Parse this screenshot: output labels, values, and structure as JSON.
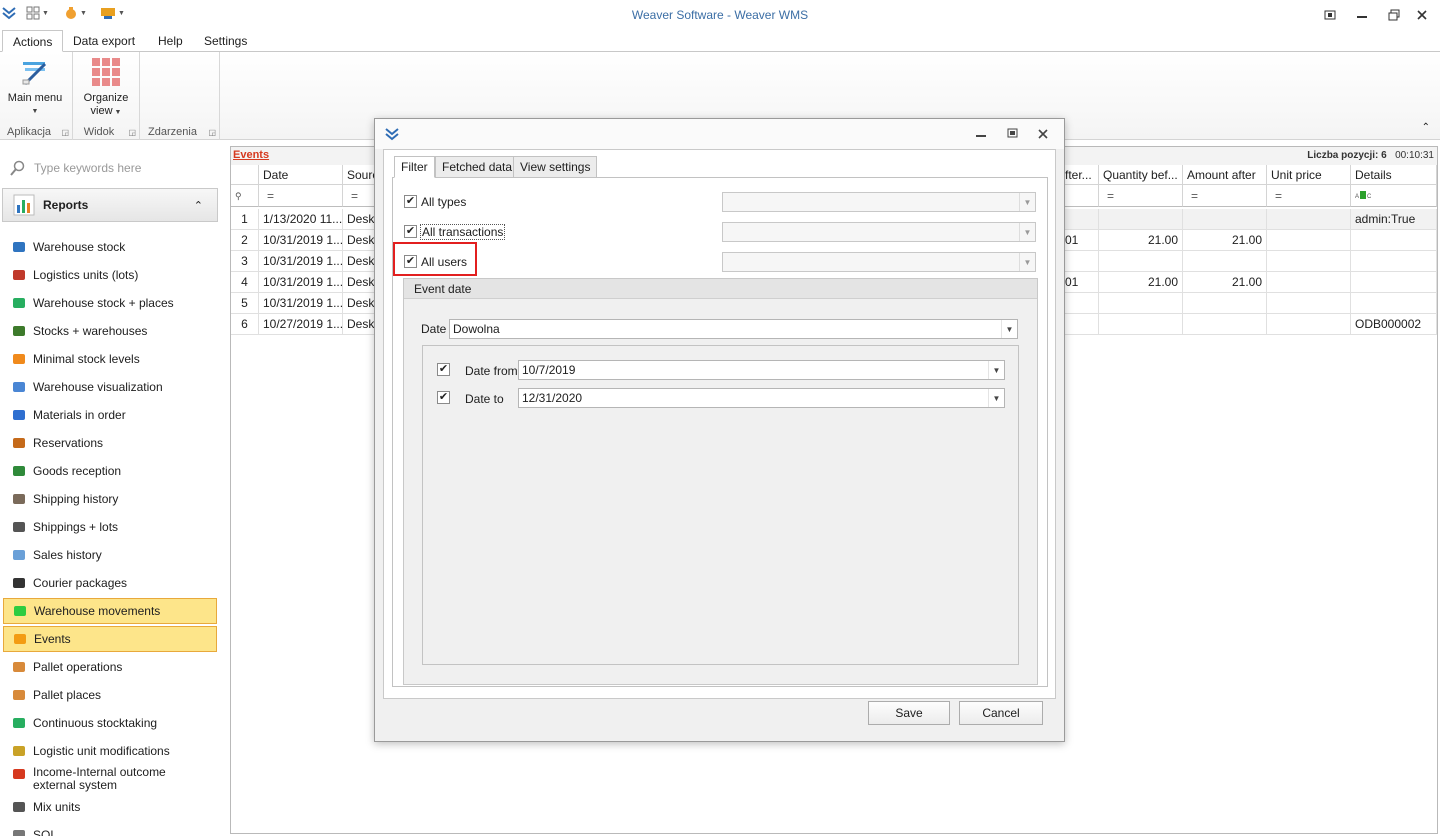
{
  "window": {
    "title": "Weaver Software - Weaver WMS"
  },
  "ribbon": {
    "tabs": [
      "Actions",
      "Data export",
      "Help",
      "Settings"
    ],
    "buttons": {
      "main_menu": "Main menu",
      "organize_view_1": "Organize",
      "organize_view_2": "view"
    },
    "groups": [
      "Aplikacja",
      "Widok",
      "Zdarzenia"
    ]
  },
  "sidebar": {
    "search_placeholder": "Type keywords here",
    "header": "Reports",
    "items": [
      {
        "label": "Warehouse stock",
        "icon": "warehouse-stock-icon",
        "color": "#2f74c0"
      },
      {
        "label": "Logistics units (lots)",
        "icon": "logistics-units-icon",
        "color": "#c0392b"
      },
      {
        "label": "Warehouse stock + places",
        "icon": "stock-places-icon",
        "color": "#27ae60"
      },
      {
        "label": "Stocks + warehouses",
        "icon": "truck-icon",
        "color": "#3d7a2b"
      },
      {
        "label": "Minimal stock levels",
        "icon": "down-arrow-icon",
        "color": "#f08a1c"
      },
      {
        "label": "Warehouse visualization",
        "icon": "map-icon",
        "color": "#4a86d4"
      },
      {
        "label": "Materials in order",
        "icon": "flag-icon",
        "color": "#2e6fd0"
      },
      {
        "label": "Reservations",
        "icon": "tag-icon",
        "color": "#c56a1a"
      },
      {
        "label": "Goods reception",
        "icon": "delivery-truck-icon",
        "color": "#2f8a3a"
      },
      {
        "label": "Shipping history",
        "icon": "shipping-icon",
        "color": "#7a6a5a"
      },
      {
        "label": "Shippings + lots",
        "icon": "pallet-truck-icon",
        "color": "#555555"
      },
      {
        "label": "Sales history",
        "icon": "sales-icon",
        "color": "#6aa0d8"
      },
      {
        "label": "Courier packages",
        "icon": "plane-icon",
        "color": "#333333"
      },
      {
        "label": "Warehouse movements",
        "icon": "arrow-right-icon",
        "color": "#2ecc40"
      },
      {
        "label": "Events",
        "icon": "lightning-icon",
        "color": "#f39c12"
      },
      {
        "label": "Pallet operations",
        "icon": "pallet-icon",
        "color": "#d88a3a"
      },
      {
        "label": "Pallet places",
        "icon": "pallet-place-icon",
        "color": "#d88a3a"
      },
      {
        "label": "Continuous stocktaking",
        "icon": "refresh-icon",
        "color": "#27ae60"
      },
      {
        "label": "Logistic unit modifications",
        "icon": "edit-icon",
        "color": "#c9a227"
      },
      {
        "label": "Income-Internal outcome external system",
        "icon": "exchange-icon",
        "color": "#d6391f"
      },
      {
        "label": "Mix units",
        "icon": "mix-icon",
        "color": "#555555"
      },
      {
        "label": "SQL",
        "icon": "sql-icon",
        "color": "#777777"
      }
    ]
  },
  "grid": {
    "title": "Events",
    "count_label": "Liczba pozycji:",
    "count_value": "6",
    "time": "00:10:31",
    "columns_left": [
      "Date",
      "Sourc"
    ],
    "columns_right": [
      "fter...",
      "Quantity bef...",
      "Amount after",
      "Unit price",
      "Details"
    ],
    "filter_symbol": "=",
    "rows": [
      {
        "n": "1",
        "date": "1/13/2020 11...",
        "source": "Deskt",
        "after": "",
        "qty": "",
        "amount": "",
        "price": "",
        "details": "admin:True"
      },
      {
        "n": "2",
        "date": "10/31/2019 1...",
        "source": "Deskt",
        "after": "01",
        "qty": "21.00",
        "amount": "21.00",
        "price": "",
        "details": ""
      },
      {
        "n": "3",
        "date": "10/31/2019 1...",
        "source": "Deskt",
        "after": "",
        "qty": "",
        "amount": "",
        "price": "",
        "details": ""
      },
      {
        "n": "4",
        "date": "10/31/2019 1...",
        "source": "Deskt",
        "after": "01",
        "qty": "21.00",
        "amount": "21.00",
        "price": "",
        "details": ""
      },
      {
        "n": "5",
        "date": "10/31/2019 1...",
        "source": "Deskt",
        "after": "",
        "qty": "",
        "amount": "",
        "price": "",
        "details": ""
      },
      {
        "n": "6",
        "date": "10/27/2019 1...",
        "source": "Deskt",
        "after": "",
        "qty": "",
        "amount": "",
        "price": "",
        "details": "ODB000002"
      }
    ]
  },
  "dialog": {
    "tabs": [
      "Filter",
      "Fetched data",
      "View settings"
    ],
    "all_types": "All types",
    "all_transactions": "All transactions",
    "all_users": "All users",
    "event_date": "Event date",
    "date_label": "Date",
    "date_value": "Dowolna",
    "date_from_label": "Date from",
    "date_from_value": "10/7/2019",
    "date_to_label": "Date to",
    "date_to_value": "12/31/2020",
    "save": "Save",
    "cancel": "Cancel"
  },
  "colors": {
    "accent": "#3b6ea5",
    "selected_bg": "#fde58a",
    "highlight": "#e21f1f"
  }
}
